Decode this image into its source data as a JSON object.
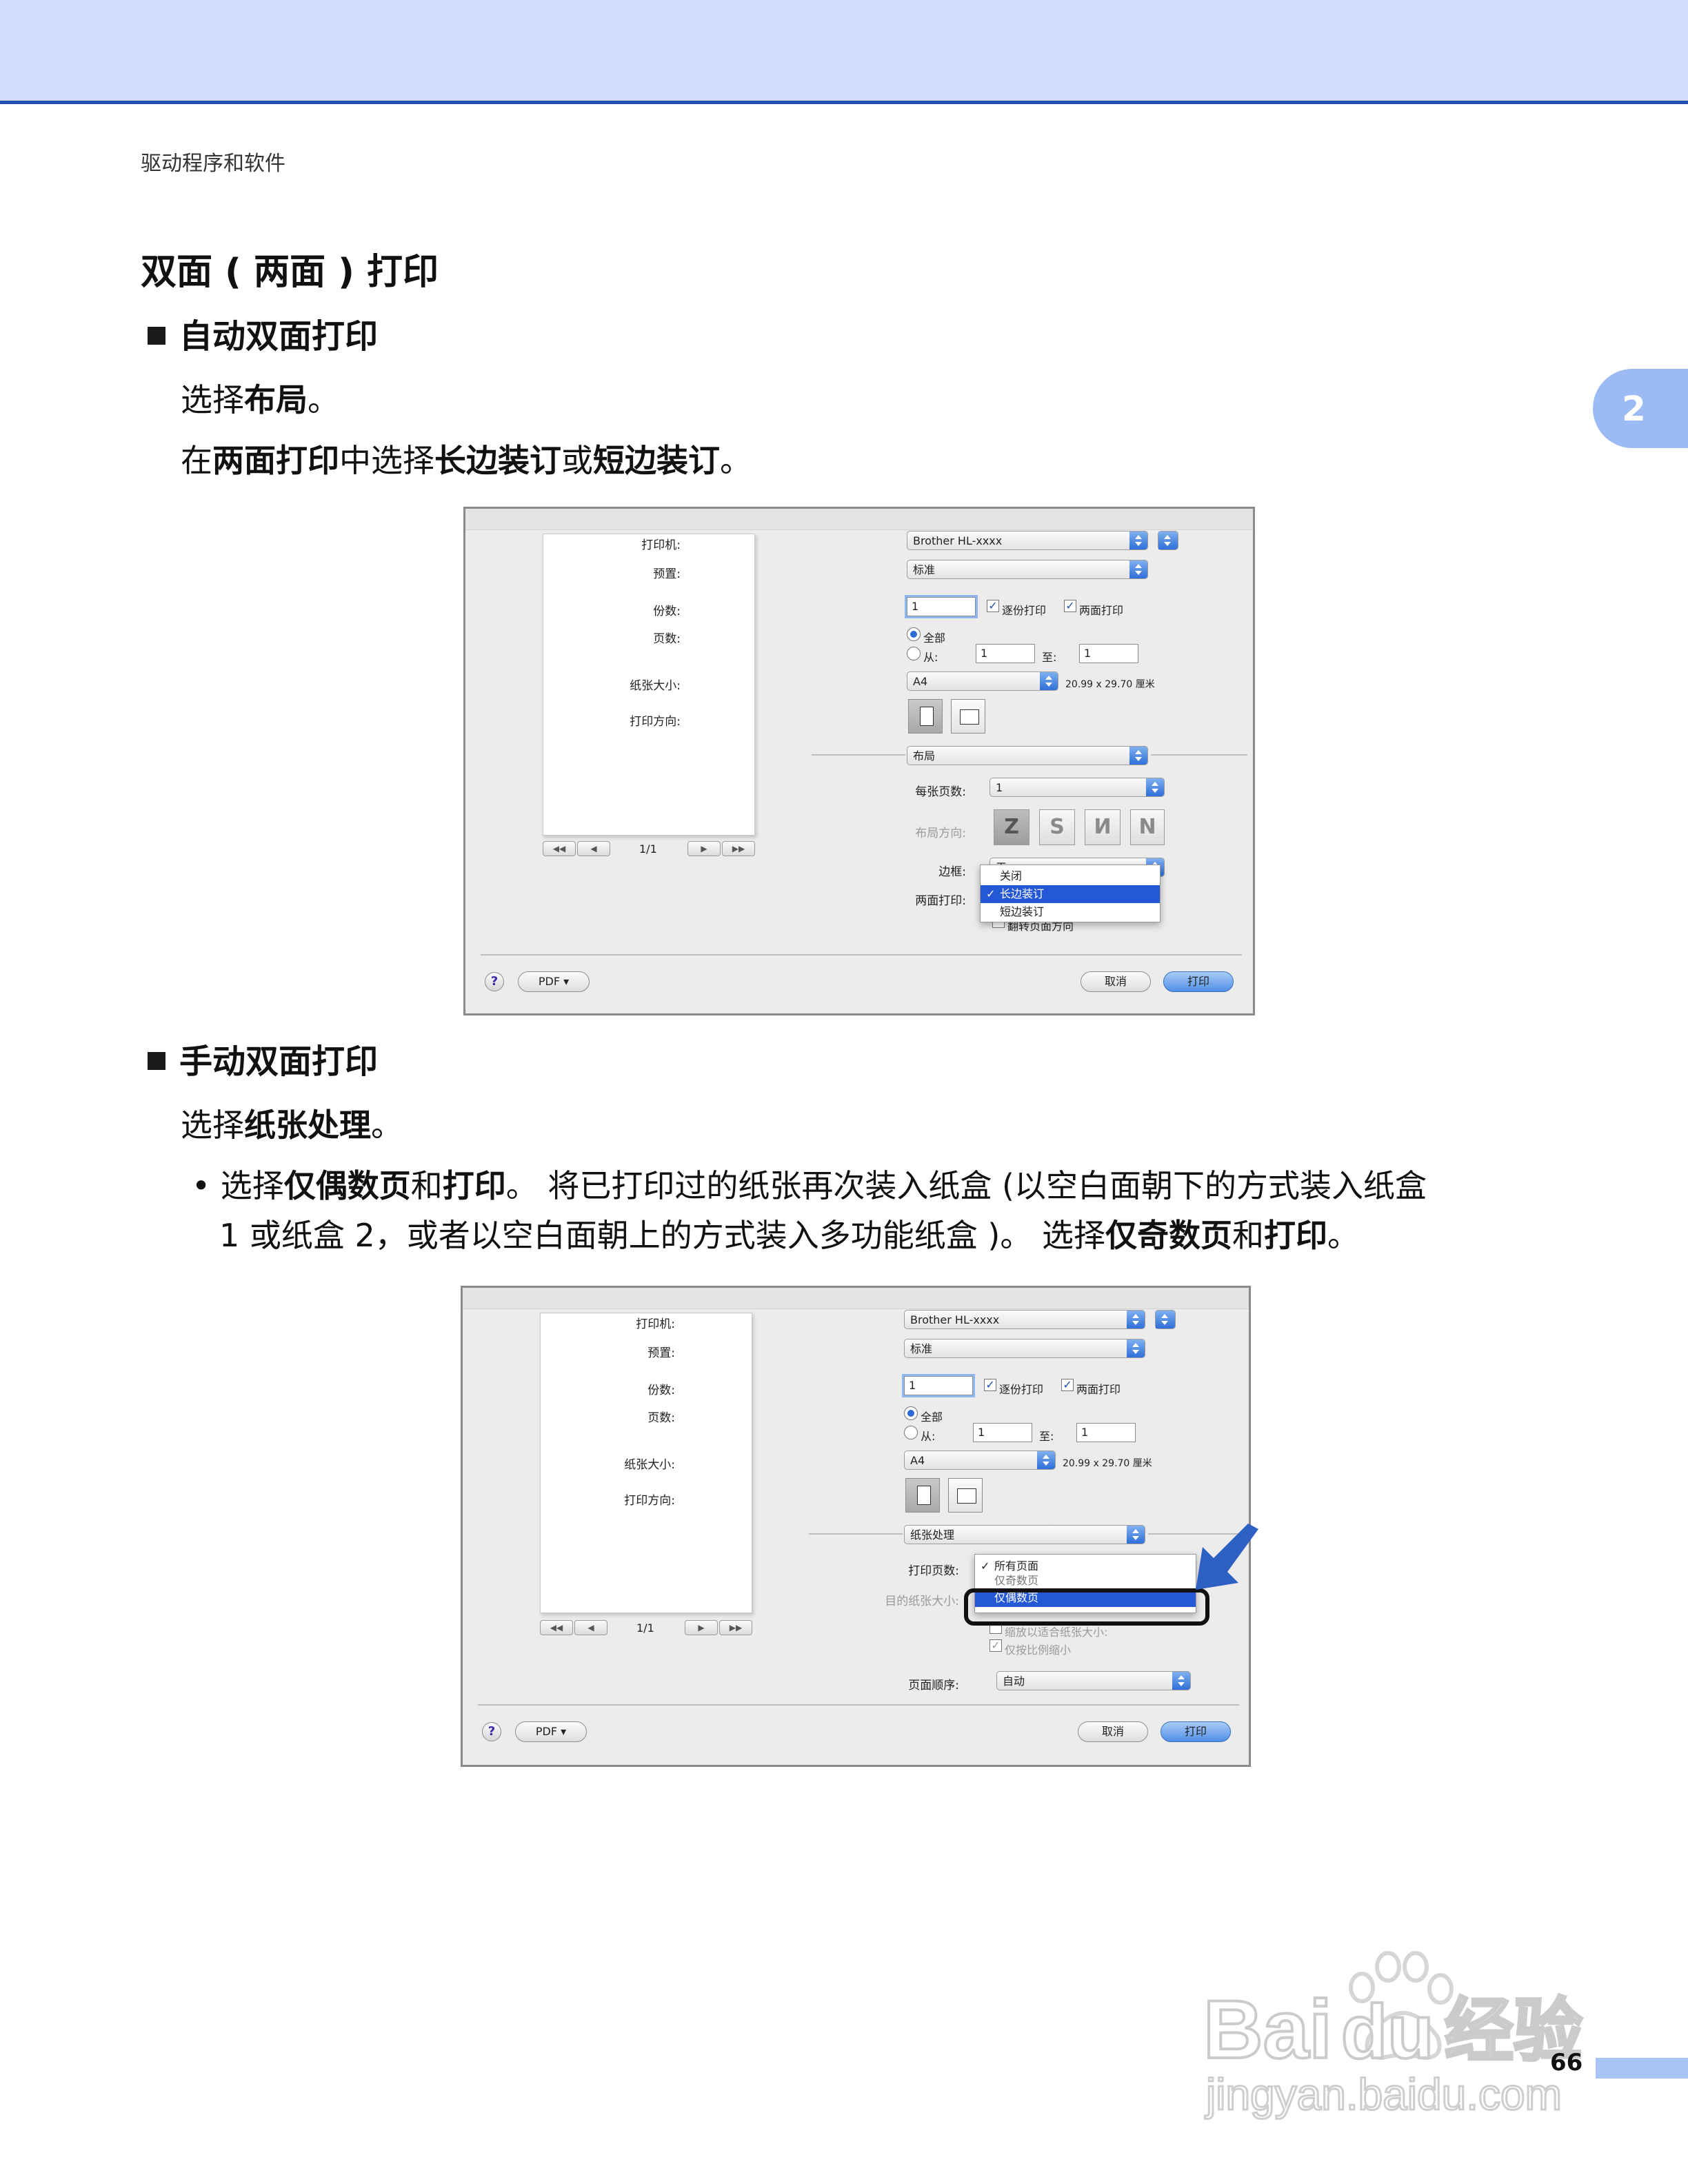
{
  "running_head": "驱动程序和软件",
  "chapter_tab": "2",
  "page_number": "66",
  "section_title": "双面 ( 两面 ) 打印",
  "auto": {
    "heading": "自动双面打印",
    "step1": {
      "pre": "选择",
      "b1": "布局",
      "post": "。"
    },
    "step2": {
      "pre": "在",
      "b1": "两面打印",
      "mid1": "中选择",
      "b2": "长边装订",
      "mid2": "或",
      "b3": "短边装订",
      "post": "。"
    }
  },
  "manual": {
    "heading": "手动双面打印",
    "step1": {
      "pre": "选择",
      "b1": "纸张处理",
      "post": "。"
    },
    "bullet": {
      "marker": "•",
      "l1_pre": "选择",
      "l1_b1": "仅偶数页",
      "l1_mid": "和",
      "l1_b2": "打印",
      "l1_post": "。 将已打印过的纸张再次装入纸盒 (以空白面朝下的方式装入纸盒",
      "l2_pre": "1 或纸盒 2，或者以空白面朝上的方式装入多功能纸盒 )。 选择",
      "l2_b1": "仅奇数页",
      "l2_mid": "和",
      "l2_b2": "打印",
      "l2_post": "。"
    }
  },
  "dialog_common": {
    "printer_label": "打印机:",
    "printer_value": "Brother HL-xxxx",
    "preset_label": "预置:",
    "preset_value": "标准",
    "copies_label": "份数:",
    "copies_value": "1",
    "collate": "逐份打印",
    "two_sided": "两面打印",
    "pages_label": "页数:",
    "pages_all": "全部",
    "pages_from": "从:",
    "from_value": "1",
    "pages_to": "至:",
    "to_value": "1",
    "paper_size_label": "纸张大小:",
    "paper_size_value": "A4",
    "paper_dims": "20.99 x 29.70 厘米",
    "orientation_label": "打印方向:",
    "page_indicator": "1/1",
    "nav_first": "◀◀",
    "nav_prev": "◀",
    "nav_next": "▶",
    "nav_last": "▶▶",
    "help": "?",
    "pdf": "PDF ▾",
    "cancel": "取消",
    "print": "打印"
  },
  "dialog1": {
    "section_value": "布局",
    "pages_per_sheet_label": "每张页数:",
    "pages_per_sheet_value": "1",
    "layout_direction_label": "布局方向:",
    "border_label": "边框:",
    "border_value": "无",
    "two_sided_label": "两面打印:",
    "menu_items": [
      {
        "label": "关闭",
        "checked": false,
        "selected": false
      },
      {
        "label": "长边装订",
        "checked": true,
        "selected": true
      },
      {
        "label": "短边装订",
        "checked": false,
        "selected": false
      }
    ],
    "obscured_option": "翻转页面方向"
  },
  "dialog2": {
    "section_value": "纸张处理",
    "pages_to_print_label": "打印页数:",
    "dest_paper_label": "目的纸张大小:",
    "menu_items": [
      {
        "label": "所有页面",
        "checked": true,
        "selected": false
      },
      {
        "label": "仅奇数页",
        "checked": false,
        "selected": false
      },
      {
        "label": "仅偶数页",
        "checked": false,
        "selected": true
      }
    ],
    "scale_option": "缩放以适合纸张大小:",
    "scale_down_only": "仅按比例缩小",
    "page_order_label": "页面顺序:",
    "page_order_value": "自动"
  },
  "colors": {
    "header_band": "#cfdcfb",
    "header_rule": "#1f4fb0",
    "tab": "#9cbaf4",
    "menu_selection": "#2558d6",
    "callout_arrow": "#2e5fc2"
  }
}
